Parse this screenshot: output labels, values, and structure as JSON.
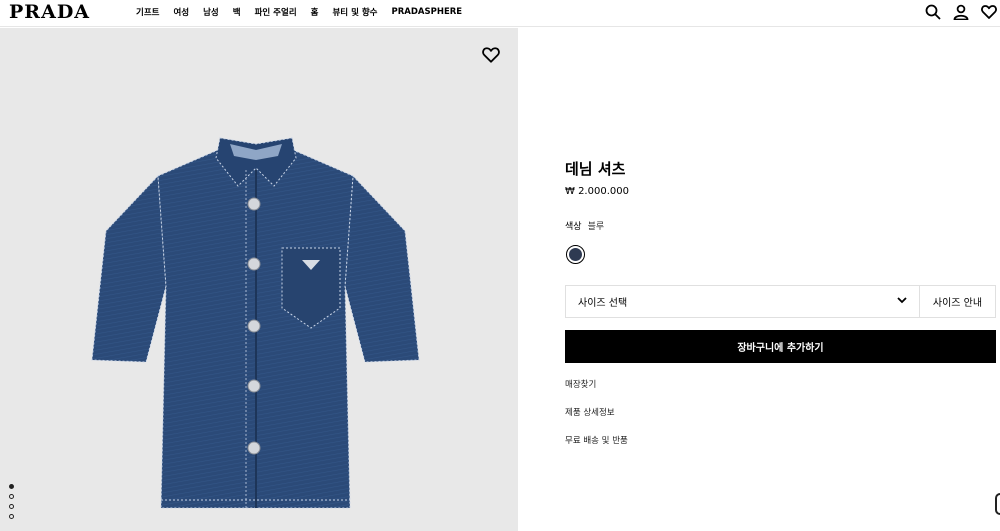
{
  "brand": {
    "logo": "PRADA"
  },
  "nav": {
    "items": [
      {
        "label": "기프트"
      },
      {
        "label": "여성"
      },
      {
        "label": "남성"
      },
      {
        "label": "백"
      },
      {
        "label": "파인 주얼리"
      },
      {
        "label": "홈"
      },
      {
        "label": "뷰티 및 향수"
      },
      {
        "label": "PRADASPHERE"
      }
    ]
  },
  "header_icons": [
    "search-icon",
    "account-icon",
    "wishlist-icon"
  ],
  "gallery": {
    "favorite_icon": "heart-icon",
    "slide_count": 4,
    "active_slide": 1,
    "colors": {
      "background": "#e8e8e8",
      "denim": "#2b4a78",
      "denim_dark": "#1f3a63"
    }
  },
  "product": {
    "name": "데님 셔츠",
    "price": "₩ 2.000.000",
    "color_label": "색상",
    "color_value": "블루",
    "swatch_color": "#2e3a52",
    "size_select_label": "사이즈 선택",
    "size_guide_label": "사이즈 안내",
    "add_to_cart_label": "장바구니에 추가하기",
    "links": {
      "store_finder": "매장찾기",
      "details": "제품 상세정보",
      "shipping": "무료 배송 및 반품"
    }
  }
}
